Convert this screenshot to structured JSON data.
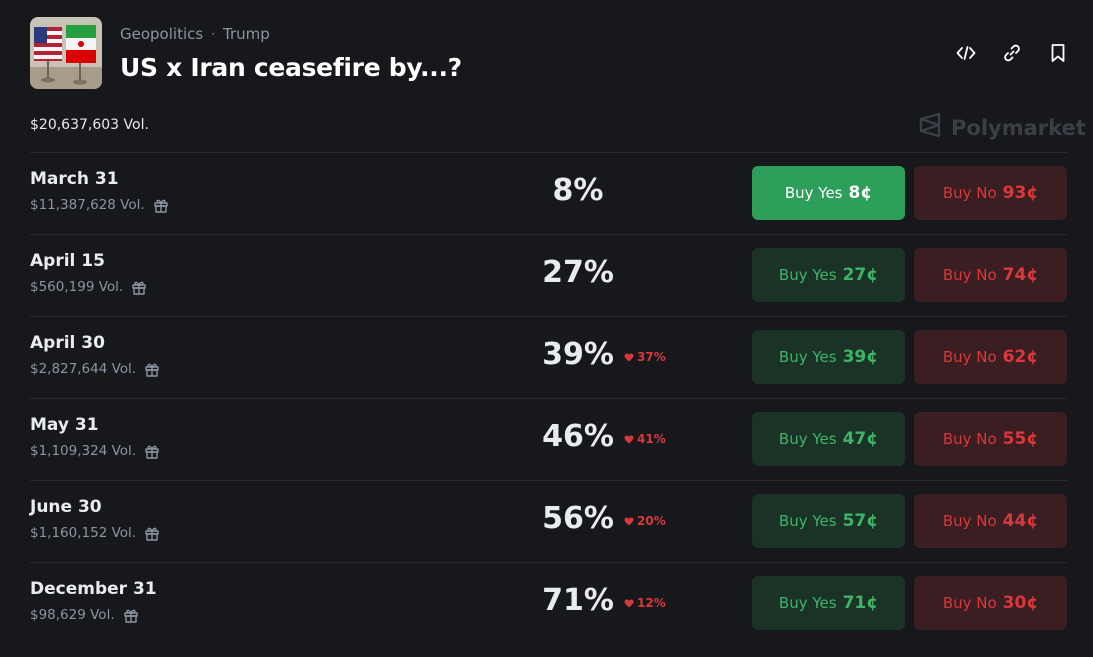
{
  "header": {
    "category": "Geopolitics",
    "separator": "·",
    "tag": "Trump",
    "title": "US x Iran ceasefire by...?"
  },
  "total_volume": "$20,637,603 Vol.",
  "brand": "Polymarket",
  "colors": {
    "background": "#16181c",
    "yes": "#3db468",
    "yes_active_bg": "#2e9e5b",
    "no": "#d9383c"
  },
  "icons": [
    "embed-icon",
    "link-icon",
    "bookmark-icon",
    "gift-icon",
    "polymarket-logo-icon",
    "caret-down-icon"
  ],
  "rows": [
    {
      "name": "March 31",
      "volume": "$11,387,628 Vol.",
      "percent": "8%",
      "change": "",
      "yes_label": "Buy Yes",
      "yes_price": "8¢",
      "no_label": "Buy No",
      "no_price": "93¢",
      "yes_active": true
    },
    {
      "name": "April 15",
      "volume": "$560,199 Vol.",
      "percent": "27%",
      "change": "",
      "yes_label": "Buy Yes",
      "yes_price": "27¢",
      "no_label": "Buy No",
      "no_price": "74¢",
      "yes_active": false
    },
    {
      "name": "April 30",
      "volume": "$2,827,644 Vol.",
      "percent": "39%",
      "change": "37%",
      "yes_label": "Buy Yes",
      "yes_price": "39¢",
      "no_label": "Buy No",
      "no_price": "62¢",
      "yes_active": false
    },
    {
      "name": "May 31",
      "volume": "$1,109,324 Vol.",
      "percent": "46%",
      "change": "41%",
      "yes_label": "Buy Yes",
      "yes_price": "47¢",
      "no_label": "Buy No",
      "no_price": "55¢",
      "yes_active": false
    },
    {
      "name": "June 30",
      "volume": "$1,160,152 Vol.",
      "percent": "56%",
      "change": "20%",
      "yes_label": "Buy Yes",
      "yes_price": "57¢",
      "no_label": "Buy No",
      "no_price": "44¢",
      "yes_active": false
    },
    {
      "name": "December 31",
      "volume": "$98,629 Vol.",
      "percent": "71%",
      "change": "12%",
      "yes_label": "Buy Yes",
      "yes_price": "71¢",
      "no_label": "Buy No",
      "no_price": "30¢",
      "yes_active": false
    }
  ]
}
